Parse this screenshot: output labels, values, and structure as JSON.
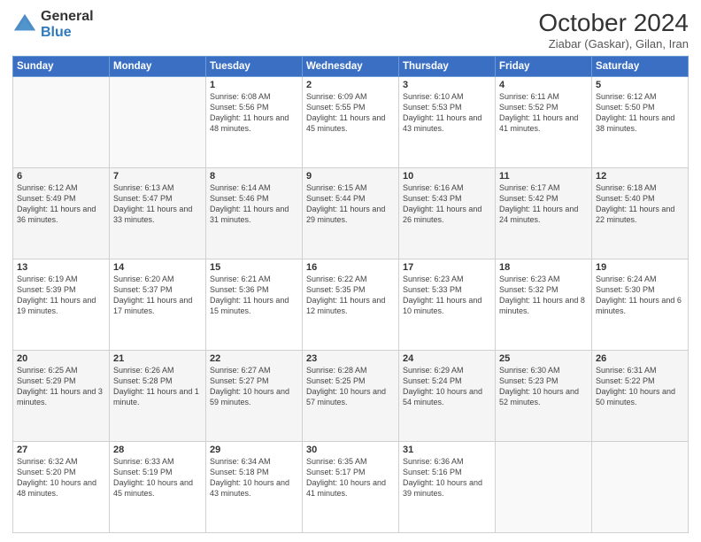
{
  "header": {
    "logo_general": "General",
    "logo_blue": "Blue",
    "month_title": "October 2024",
    "location": "Ziabar (Gaskar), Gilan, Iran"
  },
  "days_of_week": [
    "Sunday",
    "Monday",
    "Tuesday",
    "Wednesday",
    "Thursday",
    "Friday",
    "Saturday"
  ],
  "weeks": [
    [
      {
        "day": "",
        "sunrise": "",
        "sunset": "",
        "daylight": ""
      },
      {
        "day": "",
        "sunrise": "",
        "sunset": "",
        "daylight": ""
      },
      {
        "day": "1",
        "sunrise": "Sunrise: 6:08 AM",
        "sunset": "Sunset: 5:56 PM",
        "daylight": "Daylight: 11 hours and 48 minutes."
      },
      {
        "day": "2",
        "sunrise": "Sunrise: 6:09 AM",
        "sunset": "Sunset: 5:55 PM",
        "daylight": "Daylight: 11 hours and 45 minutes."
      },
      {
        "day": "3",
        "sunrise": "Sunrise: 6:10 AM",
        "sunset": "Sunset: 5:53 PM",
        "daylight": "Daylight: 11 hours and 43 minutes."
      },
      {
        "day": "4",
        "sunrise": "Sunrise: 6:11 AM",
        "sunset": "Sunset: 5:52 PM",
        "daylight": "Daylight: 11 hours and 41 minutes."
      },
      {
        "day": "5",
        "sunrise": "Sunrise: 6:12 AM",
        "sunset": "Sunset: 5:50 PM",
        "daylight": "Daylight: 11 hours and 38 minutes."
      }
    ],
    [
      {
        "day": "6",
        "sunrise": "Sunrise: 6:12 AM",
        "sunset": "Sunset: 5:49 PM",
        "daylight": "Daylight: 11 hours and 36 minutes."
      },
      {
        "day": "7",
        "sunrise": "Sunrise: 6:13 AM",
        "sunset": "Sunset: 5:47 PM",
        "daylight": "Daylight: 11 hours and 33 minutes."
      },
      {
        "day": "8",
        "sunrise": "Sunrise: 6:14 AM",
        "sunset": "Sunset: 5:46 PM",
        "daylight": "Daylight: 11 hours and 31 minutes."
      },
      {
        "day": "9",
        "sunrise": "Sunrise: 6:15 AM",
        "sunset": "Sunset: 5:44 PM",
        "daylight": "Daylight: 11 hours and 29 minutes."
      },
      {
        "day": "10",
        "sunrise": "Sunrise: 6:16 AM",
        "sunset": "Sunset: 5:43 PM",
        "daylight": "Daylight: 11 hours and 26 minutes."
      },
      {
        "day": "11",
        "sunrise": "Sunrise: 6:17 AM",
        "sunset": "Sunset: 5:42 PM",
        "daylight": "Daylight: 11 hours and 24 minutes."
      },
      {
        "day": "12",
        "sunrise": "Sunrise: 6:18 AM",
        "sunset": "Sunset: 5:40 PM",
        "daylight": "Daylight: 11 hours and 22 minutes."
      }
    ],
    [
      {
        "day": "13",
        "sunrise": "Sunrise: 6:19 AM",
        "sunset": "Sunset: 5:39 PM",
        "daylight": "Daylight: 11 hours and 19 minutes."
      },
      {
        "day": "14",
        "sunrise": "Sunrise: 6:20 AM",
        "sunset": "Sunset: 5:37 PM",
        "daylight": "Daylight: 11 hours and 17 minutes."
      },
      {
        "day": "15",
        "sunrise": "Sunrise: 6:21 AM",
        "sunset": "Sunset: 5:36 PM",
        "daylight": "Daylight: 11 hours and 15 minutes."
      },
      {
        "day": "16",
        "sunrise": "Sunrise: 6:22 AM",
        "sunset": "Sunset: 5:35 PM",
        "daylight": "Daylight: 11 hours and 12 minutes."
      },
      {
        "day": "17",
        "sunrise": "Sunrise: 6:23 AM",
        "sunset": "Sunset: 5:33 PM",
        "daylight": "Daylight: 11 hours and 10 minutes."
      },
      {
        "day": "18",
        "sunrise": "Sunrise: 6:23 AM",
        "sunset": "Sunset: 5:32 PM",
        "daylight": "Daylight: 11 hours and 8 minutes."
      },
      {
        "day": "19",
        "sunrise": "Sunrise: 6:24 AM",
        "sunset": "Sunset: 5:30 PM",
        "daylight": "Daylight: 11 hours and 6 minutes."
      }
    ],
    [
      {
        "day": "20",
        "sunrise": "Sunrise: 6:25 AM",
        "sunset": "Sunset: 5:29 PM",
        "daylight": "Daylight: 11 hours and 3 minutes."
      },
      {
        "day": "21",
        "sunrise": "Sunrise: 6:26 AM",
        "sunset": "Sunset: 5:28 PM",
        "daylight": "Daylight: 11 hours and 1 minute."
      },
      {
        "day": "22",
        "sunrise": "Sunrise: 6:27 AM",
        "sunset": "Sunset: 5:27 PM",
        "daylight": "Daylight: 10 hours and 59 minutes."
      },
      {
        "day": "23",
        "sunrise": "Sunrise: 6:28 AM",
        "sunset": "Sunset: 5:25 PM",
        "daylight": "Daylight: 10 hours and 57 minutes."
      },
      {
        "day": "24",
        "sunrise": "Sunrise: 6:29 AM",
        "sunset": "Sunset: 5:24 PM",
        "daylight": "Daylight: 10 hours and 54 minutes."
      },
      {
        "day": "25",
        "sunrise": "Sunrise: 6:30 AM",
        "sunset": "Sunset: 5:23 PM",
        "daylight": "Daylight: 10 hours and 52 minutes."
      },
      {
        "day": "26",
        "sunrise": "Sunrise: 6:31 AM",
        "sunset": "Sunset: 5:22 PM",
        "daylight": "Daylight: 10 hours and 50 minutes."
      }
    ],
    [
      {
        "day": "27",
        "sunrise": "Sunrise: 6:32 AM",
        "sunset": "Sunset: 5:20 PM",
        "daylight": "Daylight: 10 hours and 48 minutes."
      },
      {
        "day": "28",
        "sunrise": "Sunrise: 6:33 AM",
        "sunset": "Sunset: 5:19 PM",
        "daylight": "Daylight: 10 hours and 45 minutes."
      },
      {
        "day": "29",
        "sunrise": "Sunrise: 6:34 AM",
        "sunset": "Sunset: 5:18 PM",
        "daylight": "Daylight: 10 hours and 43 minutes."
      },
      {
        "day": "30",
        "sunrise": "Sunrise: 6:35 AM",
        "sunset": "Sunset: 5:17 PM",
        "daylight": "Daylight: 10 hours and 41 minutes."
      },
      {
        "day": "31",
        "sunrise": "Sunrise: 6:36 AM",
        "sunset": "Sunset: 5:16 PM",
        "daylight": "Daylight: 10 hours and 39 minutes."
      },
      {
        "day": "",
        "sunrise": "",
        "sunset": "",
        "daylight": ""
      },
      {
        "day": "",
        "sunrise": "",
        "sunset": "",
        "daylight": ""
      }
    ]
  ]
}
